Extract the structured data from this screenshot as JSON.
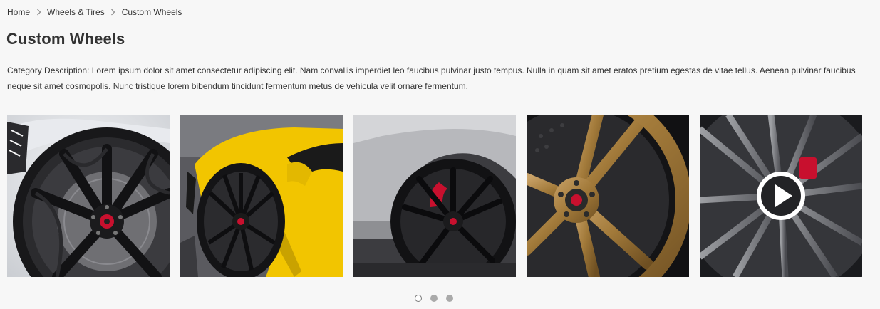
{
  "breadcrumb": {
    "items": [
      "Home",
      "Wheels & Tires",
      "Custom Wheels"
    ]
  },
  "page": {
    "title": "Custom Wheels",
    "description": "Category Description: Lorem ipsum dolor sit amet consectetur adipiscing elit. Nam convallis imperdiet leo faucibus pulvinar justo tempus. Nulla in quam sit amet eratos pretium egestas de vitae tellus. Aenean pulvinar faucibus neque sit amet cosmopolis. Nunc tristique lorem bibendum tincidunt fermentum metus de vehicula velit ornare fermentum."
  },
  "carousel": {
    "tiles": [
      {
        "subject": "black multi-spoke wheel on white car",
        "media": "image"
      },
      {
        "subject": "black wheel on yellow supercar",
        "media": "image"
      },
      {
        "subject": "black wheel with red caliper on silver car",
        "media": "image"
      },
      {
        "subject": "bronze split-spoke wheel",
        "media": "image"
      },
      {
        "subject": "gunmetal multi-spoke wheel",
        "media": "video"
      }
    ],
    "pagination": {
      "pages": 3,
      "active_page": 1
    }
  },
  "icons": {
    "separator": "chevron-right-icon",
    "play": "play-circle-icon"
  },
  "colors": {
    "background": "#f7f7f7",
    "text": "#333333",
    "yellow_car": "#f2c500",
    "bronze_wheel": "#a27a3a",
    "red_caliper": "#c8102e",
    "dot_inactive": "#aaaaaa"
  }
}
